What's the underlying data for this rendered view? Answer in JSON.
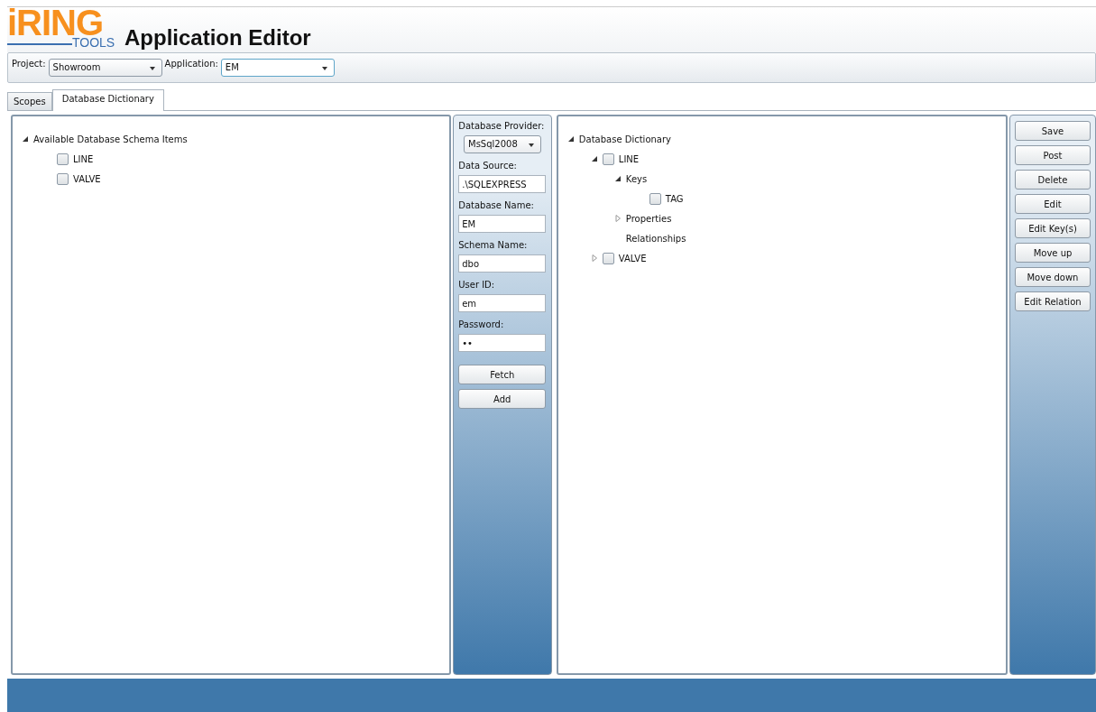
{
  "header": {
    "logo": {
      "main": "iRING",
      "sub": "TOOLS"
    },
    "title": "Application Editor"
  },
  "toolbar": {
    "project": {
      "label": "Project:",
      "value": "Showroom"
    },
    "application": {
      "label": "Application:",
      "value": "EM"
    }
  },
  "tabs": [
    {
      "label": "Scopes",
      "selected": false
    },
    {
      "label": "Database Dictionary",
      "selected": true
    }
  ],
  "schema_tree": {
    "label": "Available Database Schema Items",
    "expanded": true,
    "children": [
      {
        "label": "LINE",
        "checked": false
      },
      {
        "label": "VALVE",
        "checked": false
      }
    ]
  },
  "connection": {
    "provider_label": "Database Provider:",
    "provider": "MsSql2008",
    "fields": [
      {
        "label": "Data Source:",
        "value": ".\\SQLEXPRESS",
        "kind": "text"
      },
      {
        "label": "Database Name:",
        "value": "EM",
        "kind": "text"
      },
      {
        "label": "Schema Name:",
        "value": "dbo",
        "kind": "text"
      },
      {
        "label": "User ID:",
        "value": "em",
        "kind": "text"
      },
      {
        "label": "Password:",
        "value": "••",
        "kind": "password"
      }
    ],
    "buttons": [
      "Fetch",
      "Add"
    ]
  },
  "dictionary_tree": {
    "label": "Database Dictionary",
    "expanded": true,
    "children": [
      {
        "label": "LINE",
        "checked": false,
        "expanded": true,
        "children": [
          {
            "label": "Keys",
            "expanded": true,
            "children": [
              {
                "label": "TAG",
                "checked": false
              }
            ]
          },
          {
            "label": "Properties",
            "expanded": false
          },
          {
            "label": "Relationships"
          }
        ]
      },
      {
        "label": "VALVE",
        "checked": false,
        "expanded": false
      }
    ]
  },
  "actions": [
    "Save",
    "Post",
    "Delete",
    "Edit",
    "Edit Key(s)",
    "Move up",
    "Move down",
    "Edit Relation"
  ]
}
